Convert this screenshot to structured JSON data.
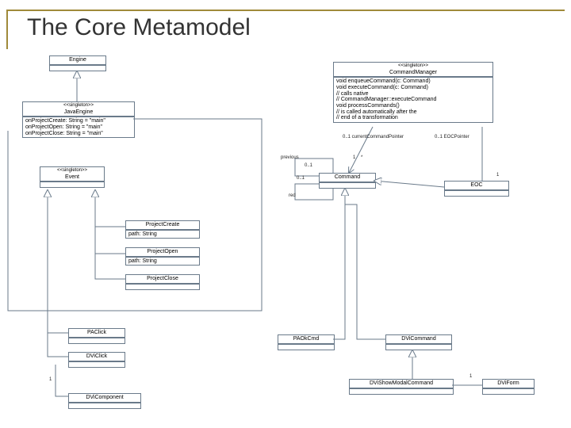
{
  "title": "The Core Metamodel",
  "stereotype_singleton": "<<singleton>>",
  "classes": {
    "engine": {
      "name": "Engine"
    },
    "javaengine": {
      "name": "JavaEngine",
      "attrs": [
        "onProjectCreate: String = \"main\"",
        "onProjectOpen: String = \"main\"",
        "onProjectClose: String = \"main\""
      ]
    },
    "event": {
      "name": "Event"
    },
    "projectcreate": {
      "name": "ProjectCreate",
      "attrs": [
        "path: String"
      ]
    },
    "projectopen": {
      "name": "ProjectOpen",
      "attrs": [
        "path: String"
      ]
    },
    "projectclose": {
      "name": "ProjectClose"
    },
    "commandmanager": {
      "name": "CommandManager",
      "ops": [
        "void enqueueCommand(c: Command)",
        "void executeCommand(c: Command)",
        "// calls native",
        "// CommandManager::executeCommand",
        "void processCommands()",
        "// is called automatically after the",
        "// end of a transformation"
      ]
    },
    "command": {
      "name": "Command"
    },
    "eoc": {
      "name": "EOC"
    },
    "paclick": {
      "name": "PAClick"
    },
    "dviclick": {
      "name": "DViClick"
    },
    "dvcomponent": {
      "name": "DViComponent"
    },
    "paokcmd": {
      "name": "PAOkCmd"
    },
    "dvicommand": {
      "name": "DViCommand"
    },
    "dvishowmodal": {
      "name": "DViShowModalCommand"
    },
    "dviform": {
      "name": "DViForm"
    }
  },
  "labels": {
    "previous": "previous",
    "red": "red",
    "currentptr": "0..1 currentCommandPointer",
    "eocptr": "0..1 EOCPointer",
    "m01": "0..1",
    "m1": "1",
    "mstar": "*"
  },
  "chart_data": {
    "type": "diagram",
    "diagram_type": "UML class diagram",
    "title": "The Core Metamodel",
    "nodes": [
      {
        "id": "Engine",
        "stereotype": null
      },
      {
        "id": "JavaEngine",
        "stereotype": "singleton",
        "attributes": [
          "onProjectCreate: String = \"main\"",
          "onProjectOpen: String = \"main\"",
          "onProjectClose: String = \"main\""
        ]
      },
      {
        "id": "Event",
        "stereotype": "singleton"
      },
      {
        "id": "ProjectCreate",
        "attributes": [
          "path: String"
        ]
      },
      {
        "id": "ProjectOpen",
        "attributes": [
          "path: String"
        ]
      },
      {
        "id": "ProjectClose"
      },
      {
        "id": "CommandManager",
        "stereotype": "singleton",
        "operations": [
          "enqueueCommand(c: Command): void",
          "executeCommand(c: Command): void",
          "processCommands(): void"
        ]
      },
      {
        "id": "Command"
      },
      {
        "id": "EOC"
      },
      {
        "id": "PAClick"
      },
      {
        "id": "DViClick"
      },
      {
        "id": "DViComponent"
      },
      {
        "id": "PAOkCmd"
      },
      {
        "id": "DViCommand"
      },
      {
        "id": "DViShowModalCommand"
      },
      {
        "id": "DViForm"
      }
    ],
    "edges": [
      {
        "from": "JavaEngine",
        "to": "Engine",
        "type": "generalization"
      },
      {
        "from": "ProjectCreate",
        "to": "Event",
        "type": "generalization"
      },
      {
        "from": "ProjectOpen",
        "to": "Event",
        "type": "generalization"
      },
      {
        "from": "ProjectClose",
        "to": "Event",
        "type": "generalization"
      },
      {
        "from": "PAClick",
        "to": "Event",
        "type": "generalization"
      },
      {
        "from": "DViClick",
        "to": "Event",
        "type": "generalization"
      },
      {
        "from": "EOC",
        "to": "Command",
        "type": "generalization"
      },
      {
        "from": "PAOkCmd",
        "to": "Command",
        "type": "generalization"
      },
      {
        "from": "DViCommand",
        "to": "Command",
        "type": "generalization"
      },
      {
        "from": "DViShowModalCommand",
        "to": "DViCommand",
        "type": "generalization"
      },
      {
        "from": "CommandManager",
        "to": "Command",
        "type": "association",
        "roles": {
          "currentCommandPointer": "0..1",
          "EOCPointer": "0..1",
          "queue": "*"
        }
      },
      {
        "from": "Command",
        "to": "Command",
        "type": "association",
        "role": "previous",
        "multiplicity": "0..1"
      },
      {
        "from": "Command",
        "to": "Command",
        "type": "association",
        "role": "red",
        "multiplicity": "0..1"
      },
      {
        "from": "CommandManager",
        "to": "EOC",
        "type": "association",
        "multiplicity": "1"
      },
      {
        "from": "DViClick",
        "to": "DViComponent",
        "type": "association",
        "multiplicity": "1"
      },
      {
        "from": "DViShowModalCommand",
        "to": "DViForm",
        "type": "association",
        "multiplicity": "1"
      },
      {
        "from": "JavaEngine",
        "to": "CommandManager",
        "type": "association"
      }
    ]
  }
}
